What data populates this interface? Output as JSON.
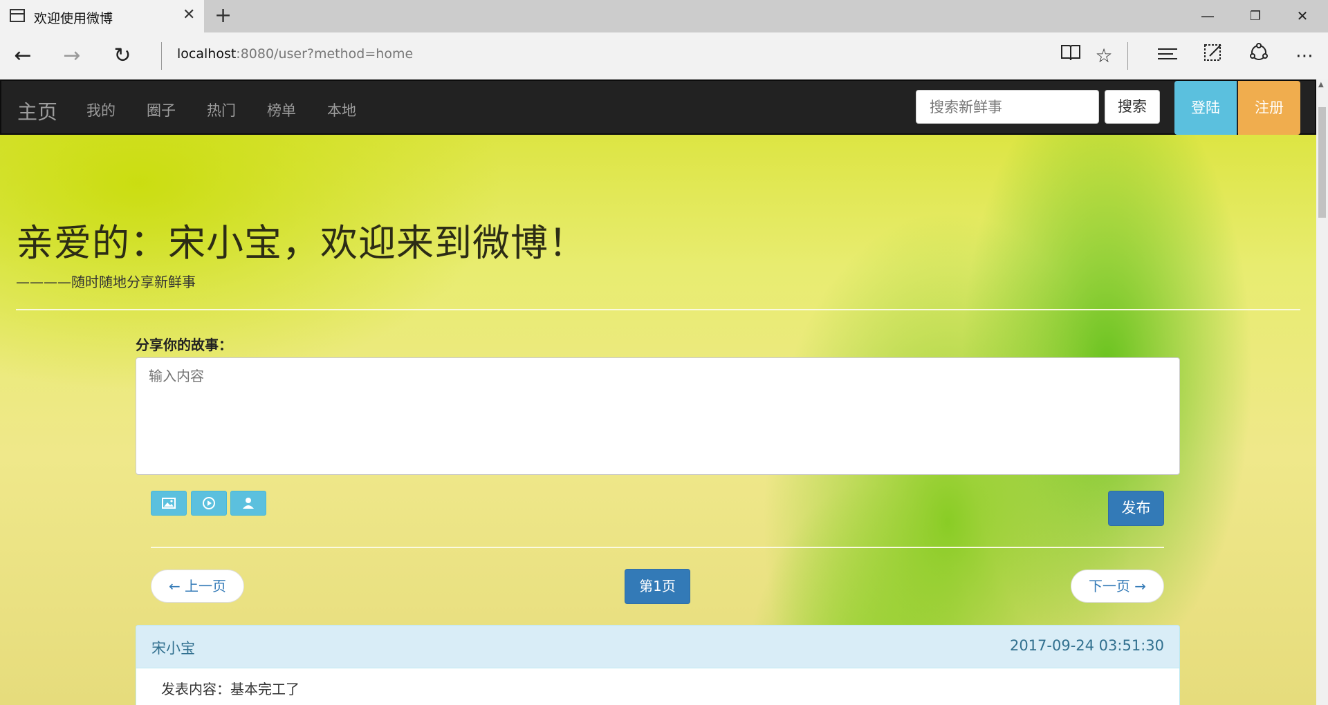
{
  "browser": {
    "tab_title": "欢迎使用微博",
    "url_host": "localhost",
    "url_rest": ":8080/user?method=home",
    "icons": [
      "back-icon",
      "forward-icon",
      "refresh-icon",
      "reading-view-icon",
      "favorite-star-icon",
      "hub-icon",
      "web-note-icon",
      "share-icon",
      "more-icon"
    ]
  },
  "navbar": {
    "brand": "主页",
    "links": [
      "我的",
      "圈子",
      "热门",
      "榜单",
      "本地"
    ],
    "search_placeholder": "搜索新鲜事",
    "search_button": "搜索",
    "login": "登陆",
    "register": "注册"
  },
  "hero": {
    "headline": "亲爱的：宋小宝，欢迎来到微博！",
    "subline": "————随时随地分享新鲜事"
  },
  "composer": {
    "label": "分享你的故事：",
    "placeholder": "输入内容",
    "media_buttons": [
      "picture-icon",
      "video-icon",
      "user-icon"
    ],
    "publish": "发布"
  },
  "pager": {
    "prev": "← 上一页",
    "current": "第1页",
    "next": "下一页 →"
  },
  "posts": [
    {
      "author": "宋小宝",
      "time": "2017-09-24 03:51:30",
      "content": "发表内容：基本完工了"
    }
  ],
  "colors": {
    "navbar_bg": "#222222",
    "info": "#5bc0de",
    "warning": "#f0ad4e",
    "primary": "#337ab7",
    "panel_heading": "#d9edf7"
  }
}
